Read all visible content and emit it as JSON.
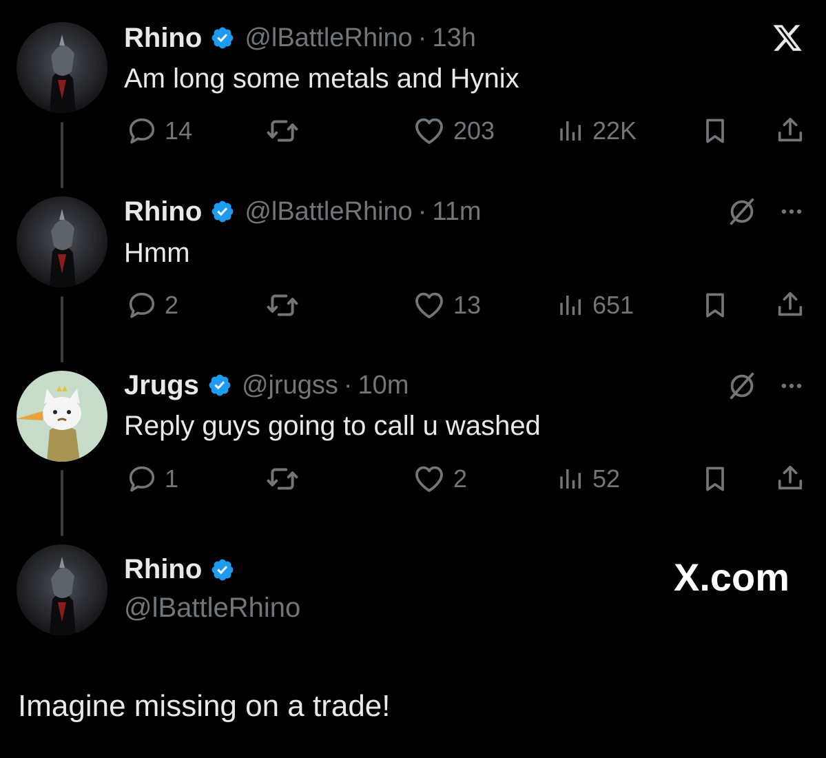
{
  "colors": {
    "background": "#000000",
    "text": "#e7e9ea",
    "muted": "#71767b",
    "verified": "#1d9bf0",
    "thread_line": "#3a3d40"
  },
  "tweets": [
    {
      "name": "Rhino",
      "handle": "@lBattleRhino",
      "time": "13h",
      "text": "Am long some metals and Hynix",
      "replies": "14",
      "likes": "203",
      "views": "22K",
      "top_icon": "x-logo-icon"
    },
    {
      "name": "Rhino",
      "handle": "@lBattleRhino",
      "time": "11m",
      "text": "Hmm",
      "replies": "2",
      "likes": "13",
      "views": "651",
      "top_icon": "grok-icon"
    },
    {
      "name": "Jrugs",
      "handle": "@jrugss",
      "time": "10m",
      "text": "Reply guys going to call u washed",
      "replies": "1",
      "likes": "2",
      "views": "52",
      "top_icon": "grok-icon"
    }
  ],
  "quote": {
    "name": "Rhino",
    "handle": "@lBattleRhino",
    "brand": "X.com",
    "text": "Imagine missing on a trade!"
  }
}
